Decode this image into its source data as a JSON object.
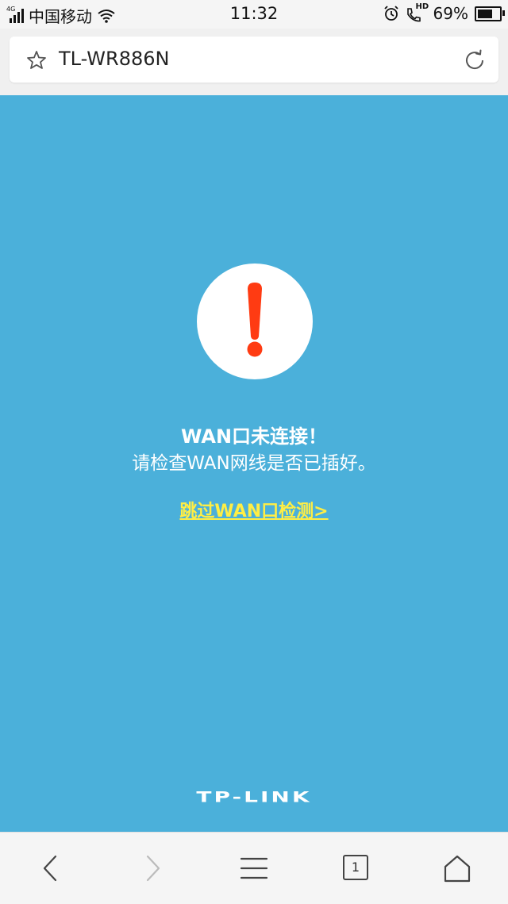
{
  "status_bar": {
    "network": "4G",
    "carrier": "中国移动",
    "time": "11:32",
    "call_indicator": "HD",
    "battery_percent": "69%",
    "battery_level": 0.69
  },
  "browser": {
    "page_title": "TL-WR886N",
    "icons": {
      "bookmark": "star-icon",
      "reload": "refresh-icon"
    }
  },
  "page": {
    "alert_icon": "exclamation-icon",
    "title": "WAN口未连接！",
    "subtitle": "请检查WAN网线是否已插好。",
    "skip_link": "跳过WAN口检测>",
    "logo": "TP-LINK",
    "colors": {
      "background": "#4bb0da",
      "alert": "#ff3b12",
      "link": "#ffee44"
    }
  },
  "bottom_bar": {
    "tab_count": "1",
    "icons": [
      "back-icon",
      "forward-icon",
      "menu-icon",
      "tabs-icon",
      "home-icon"
    ]
  }
}
